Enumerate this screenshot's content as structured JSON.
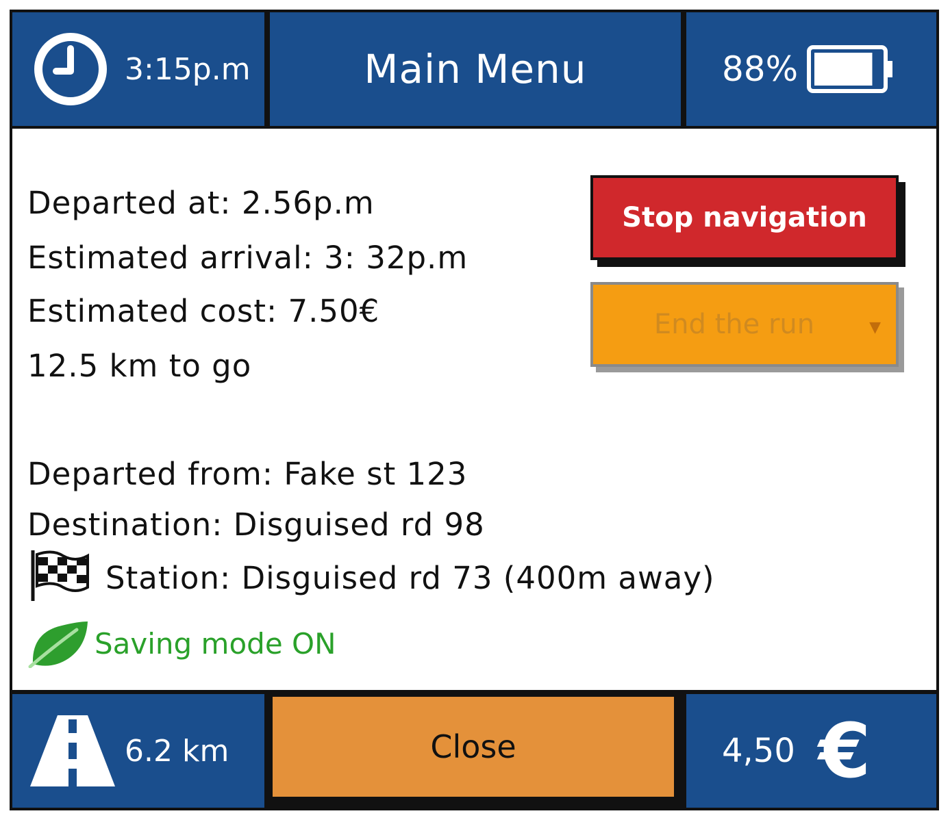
{
  "header": {
    "time": "3:15p.m",
    "title": "Main Menu",
    "battery_percent": "88%",
    "battery_level": 0.88
  },
  "trip": {
    "departed_at": "Departed at: 2.56p.m",
    "estimated_arrival": "Estimated arrival: 3: 32p.m",
    "estimated_cost": "Estimated cost: 7.50€",
    "remaining": "12.5 km to go",
    "departed_from": "Departed from: Fake st 123",
    "destination": "Destination: Disguised rd 98",
    "station": "Station: Disguised rd 73 (400m away)",
    "saving_mode": "Saving mode ON"
  },
  "actions": {
    "stop_label": "Stop navigation",
    "end_run_label": "End the run",
    "close_label": "Close"
  },
  "footer": {
    "distance": "6.2 km",
    "cost": "4,50",
    "currency_symbol": "€"
  },
  "icons": {
    "clock": "clock-icon",
    "battery": "battery-icon",
    "flag": "checkered-flag-icon",
    "leaf": "leaf-icon",
    "road": "road-icon",
    "euro": "euro-icon"
  },
  "colors": {
    "header_blue": "#1a4e8d",
    "stop_red": "#d0282c",
    "end_orange": "#f59d12",
    "close_orange": "#e4913a",
    "saving_green": "#2aa12a"
  }
}
